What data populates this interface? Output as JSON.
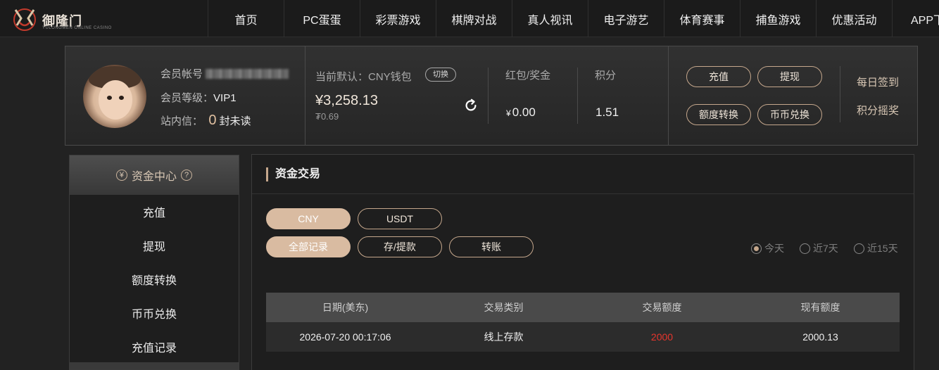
{
  "brand": {
    "name": "御隆门",
    "tagline": "YULONGMEN ONLINE CASINO"
  },
  "nav": [
    "首页",
    "PC蛋蛋",
    "彩票游戏",
    "棋牌对战",
    "真人视讯",
    "电子游艺",
    "体育赛事",
    "捕鱼游戏",
    "优惠活动",
    "APP下载"
  ],
  "account": {
    "username_label": "会员帐号",
    "level_label": "会员等级：",
    "level_value": "VIP1",
    "mail_label": "站内信：",
    "unread_count": "0",
    "unread_suffix": "封未读",
    "wallet_label": "当前默认：CNY钱包",
    "switch_label": "切换",
    "balance": "¥3,258.13",
    "balance_sub": "₮0.69",
    "redpacket_label": "红包/奖金",
    "redpacket_currency": "¥",
    "redpacket_value": "0.00",
    "points_label": "积分",
    "points_value": "1.51",
    "actions": [
      "充值",
      "提现",
      "额度转换",
      "币币兑换"
    ],
    "daily_checkin": "每日签到",
    "points_lottery": "积分摇奖"
  },
  "sidebar": {
    "title": "资金中心",
    "currency_icon": "¥",
    "help_icon": "?",
    "items": [
      "充值",
      "提现",
      "额度转换",
      "币币兑换",
      "充值记录"
    ]
  },
  "main": {
    "title": "资金交易",
    "currency_tabs": [
      "CNY",
      "USDT"
    ],
    "record_tabs": [
      "全部记录",
      "存/提款",
      "转账"
    ],
    "ranges": [
      "今天",
      "近7天",
      "近15天"
    ],
    "selected_range": "今天",
    "table": {
      "headers": [
        "日期(美东)",
        "交易类别",
        "交易额度",
        "现有额度"
      ],
      "rows": [
        [
          "2026-07-20 00:17:06",
          "线上存款",
          "2000",
          "2000.13"
        ]
      ]
    }
  },
  "colors": {
    "accent": "#c5a78c",
    "active_tab": "#d9bba1",
    "amount_red": "#e8352c"
  }
}
